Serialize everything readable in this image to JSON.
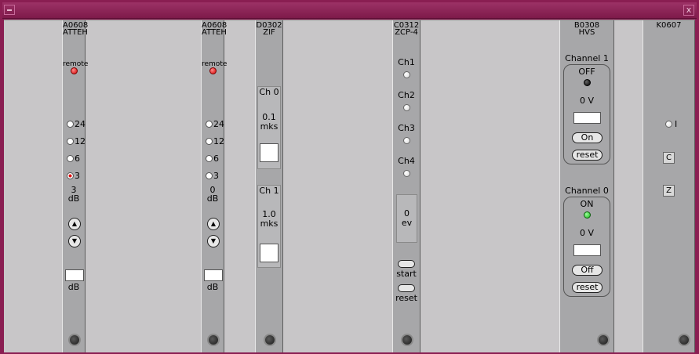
{
  "window": {
    "close_label": "x"
  },
  "modules": {
    "a0608_1": {
      "name_line1": "A0608",
      "name_line2": "ATTEH",
      "remote_label": "remote",
      "options": [
        "24",
        "12",
        "6",
        "3"
      ],
      "selected": "3",
      "value": "3",
      "unit": "dB",
      "input_unit": "dB",
      "input_value": ""
    },
    "a0608_2": {
      "name_line1": "A0608",
      "name_line2": "ATTEH",
      "remote_label": "remote",
      "options": [
        "24",
        "12",
        "6",
        "3"
      ],
      "selected": "",
      "value": "0",
      "unit": "dB",
      "input_unit": "dB",
      "input_value": ""
    },
    "d0302": {
      "name_line1": "D0302",
      "name_line2": "ZIF",
      "ch0": {
        "label": "Ch 0",
        "value": "0.1",
        "unit": "mks"
      },
      "ch1": {
        "label": "Ch 1",
        "value": "1.0",
        "unit": "mks"
      }
    },
    "c0312": {
      "name_line1": "C0312",
      "name_line2": "ZCP-4",
      "channels": [
        "Ch1",
        "Ch2",
        "Ch3",
        "Ch4"
      ],
      "count": "0",
      "count_unit": "ev",
      "start_label": "start",
      "reset_label": "reset"
    },
    "b0308": {
      "name_line1": "B0308",
      "name_line2": "HVS",
      "channel1": {
        "title": "Channel 1",
        "state": "OFF",
        "voltage": "0 V",
        "button": "On",
        "reset": "reset"
      },
      "channel0": {
        "title": "Channel 0",
        "state": "ON",
        "voltage": "0 V",
        "button": "Off",
        "reset": "reset"
      }
    },
    "k0607": {
      "name_line1": "K0607",
      "i_label": "I",
      "c_label": "C",
      "z_label": "Z"
    }
  }
}
